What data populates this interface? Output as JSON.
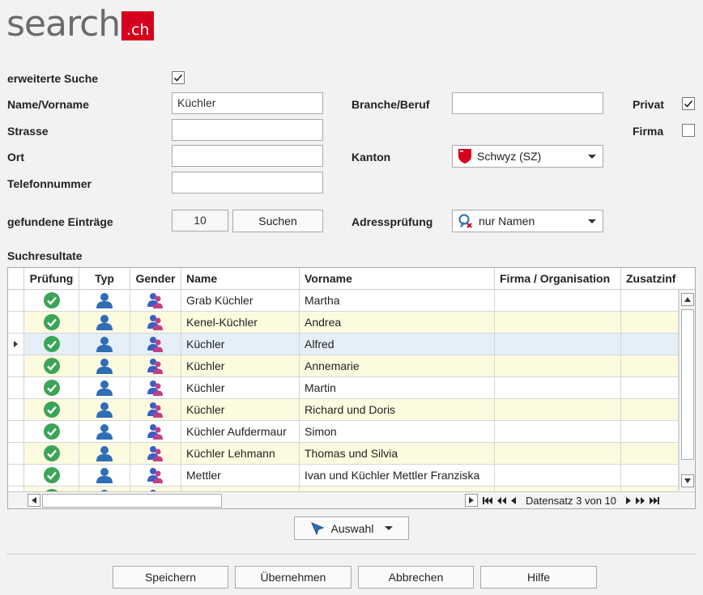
{
  "logo": {
    "text": "search",
    "suffix": ".ch"
  },
  "form": {
    "erweitert_label": "erweiterte Suche",
    "erweitert_checked": true,
    "name_label": "Name/Vorname",
    "name_value": "Küchler",
    "strasse_label": "Strasse",
    "strasse_value": "",
    "ort_label": "Ort",
    "ort_value": "",
    "telefon_label": "Telefonnummer",
    "telefon_value": "",
    "branche_label": "Branche/Beruf",
    "branche_value": "",
    "kanton_label": "Kanton",
    "kanton_value": "Schwyz (SZ)",
    "privat_label": "Privat",
    "privat_checked": true,
    "firma_label": "Firma",
    "firma_checked": false,
    "gefunden_label": "gefundene Einträge",
    "gefunden_value": "10",
    "suchen_button": "Suchen",
    "adresspruefung_label": "Adressprüfung",
    "adresspruefung_value": "nur Namen"
  },
  "results": {
    "title": "Suchresultate",
    "columns": [
      "Prüfung",
      "Typ",
      "Gender",
      "Name",
      "Vorname",
      "Firma / Organisation",
      "Zusatzinf"
    ],
    "rows": [
      {
        "name": "Grab Küchler",
        "vorname": "Martha",
        "firma": "",
        "zusatz": ""
      },
      {
        "name": "Kenel-Küchler",
        "vorname": "Andrea",
        "firma": "",
        "zusatz": ""
      },
      {
        "name": "Küchler",
        "vorname": "Alfred",
        "firma": "",
        "zusatz": ""
      },
      {
        "name": "Küchler",
        "vorname": "Annemarie",
        "firma": "",
        "zusatz": ""
      },
      {
        "name": "Küchler",
        "vorname": "Martin",
        "firma": "",
        "zusatz": ""
      },
      {
        "name": "Küchler",
        "vorname": "Richard und Doris",
        "firma": "",
        "zusatz": ""
      },
      {
        "name": "Küchler Aufdermaur",
        "vorname": "Simon",
        "firma": "",
        "zusatz": ""
      },
      {
        "name": "Küchler Lehmann",
        "vorname": "Thomas und Silvia",
        "firma": "",
        "zusatz": ""
      },
      {
        "name": "Mettler",
        "vorname": "Ivan und Küchler Mettler Franziska",
        "firma": "",
        "zusatz": ""
      }
    ],
    "selected_index": 2,
    "pager_text": "Datensatz 3 von 10"
  },
  "auswahl_button": "Auswahl",
  "footer": {
    "speichern": "Speichern",
    "uebernehmen": "Übernehmen",
    "abbrechen": "Abbrechen",
    "hilfe": "Hilfe"
  },
  "colors": {
    "brand": "#d6001c",
    "check_green": "#3aa556",
    "person_blue": "#2f6db5",
    "row_alt": "#fcfbe0",
    "row_selected": "#e4eff8"
  }
}
